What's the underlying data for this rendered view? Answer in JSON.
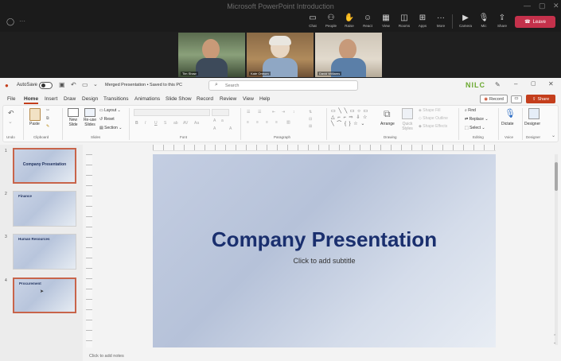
{
  "teams": {
    "title": "Microsoft PowerPoint Introduction",
    "toolbar": [
      {
        "icon": "chat-icon",
        "label": "Chat"
      },
      {
        "icon": "people-icon",
        "label": "People"
      },
      {
        "icon": "raise-hand-icon",
        "label": "Raise"
      },
      {
        "icon": "react-icon",
        "label": "React"
      },
      {
        "icon": "view-icon",
        "label": "View"
      },
      {
        "icon": "rooms-icon",
        "label": "Rooms"
      },
      {
        "icon": "apps-icon",
        "label": "Apps"
      },
      {
        "icon": "more-icon",
        "label": "More"
      },
      {
        "icon": "camera-icon",
        "label": "Camera"
      },
      {
        "icon": "mic-icon",
        "label": "Mic"
      },
      {
        "icon": "share-icon",
        "label": "Share"
      }
    ],
    "leave_label": "Leave",
    "participants": [
      {
        "name": "Tim Shaw"
      },
      {
        "name": "Kate Ontrom"
      },
      {
        "name": "David Williams"
      }
    ]
  },
  "ppt": {
    "autosave_label": "AutoSave",
    "doc_title": "Merged Presentation • Saved to this PC",
    "search_placeholder": "Search",
    "brand": "NILC",
    "tabs": [
      "File",
      "Home",
      "Insert",
      "Draw",
      "Design",
      "Transitions",
      "Animations",
      "Slide Show",
      "Record",
      "Review",
      "View",
      "Help"
    ],
    "active_tab": "Home",
    "record_label": "Record",
    "share_label": "Share",
    "ribbon": {
      "undo": "Undo",
      "paste": "Paste",
      "clipboard": "Clipboard",
      "new_slide": "New Slide",
      "reuse_slides": "Re-use Slides",
      "layout": "Layout",
      "reset": "Reset",
      "section": "Section",
      "slides": "Slides",
      "font": "Font",
      "paragraph": "Paragraph",
      "arrange": "Arrange",
      "quick_styles": "Quick Styles",
      "shape_fill": "Shape Fill",
      "shape_outline": "Shape Outline",
      "shape_effects": "Shape Effects",
      "drawing": "Drawing",
      "find": "Find",
      "replace": "Replace",
      "select": "Select",
      "editing": "Editing",
      "dictate": "Dictate",
      "voice": "Voice",
      "designer": "Designer",
      "designer_group": "Designer"
    },
    "slides": [
      {
        "num": "1",
        "title": "Company Presentation"
      },
      {
        "num": "2",
        "title": "Finance"
      },
      {
        "num": "3",
        "title": "Human Resources"
      },
      {
        "num": "4",
        "title": "Procurement"
      }
    ],
    "current_slide": {
      "title": "Company Presentation",
      "subtitle": "Click to add subtitle"
    },
    "notes_placeholder": "Click to add notes"
  }
}
